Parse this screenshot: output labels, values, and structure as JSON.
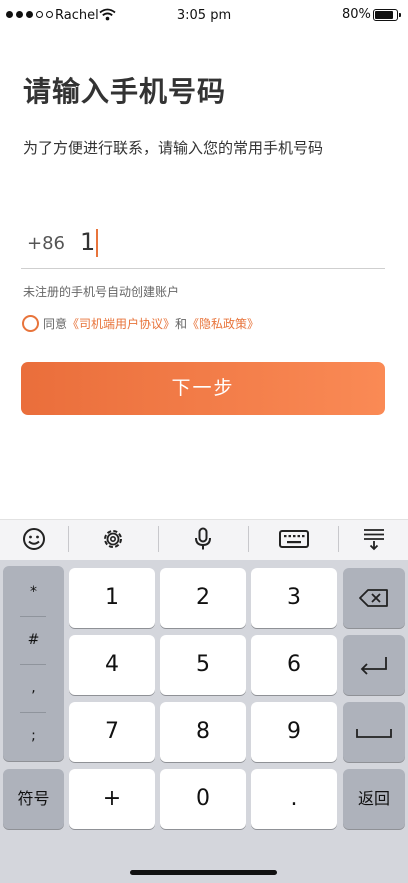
{
  "status_bar": {
    "carrier": "Rachel",
    "time": "3:05 pm",
    "battery": "80%"
  },
  "page": {
    "title": "请输入手机号码",
    "subtitle": "为了方便进行联系，请输入您的常用手机号码",
    "country_code": "+86",
    "phone_value": "1",
    "hint": "未注册的手机号自动创建账户",
    "agree_prefix": "同意",
    "agree_link1": "《司机端用户协议》",
    "agree_and": "和",
    "agree_link2": "《隐私政策》",
    "next_label": "下一步"
  },
  "keyboard": {
    "toolbar": [
      "emoji-icon",
      "gear-icon",
      "microphone-icon",
      "keyboard-icon",
      "hide-keyboard-icon"
    ],
    "side_symbols": [
      "*",
      "#",
      ",",
      ";"
    ],
    "keys": {
      "k1": "1",
      "k2": "2",
      "k3": "3",
      "k4": "4",
      "k5": "5",
      "k6": "6",
      "k7": "7",
      "k8": "8",
      "k9": "9",
      "plus": "+",
      "k0": "0",
      "dot": "."
    },
    "symbols_label": "符号",
    "return_label": "返回"
  },
  "colors": {
    "accent": "#e8743b",
    "button_start": "#ea6e3b",
    "button_end": "#fa8a55",
    "keyboard_bg": "#d4d6dc"
  }
}
